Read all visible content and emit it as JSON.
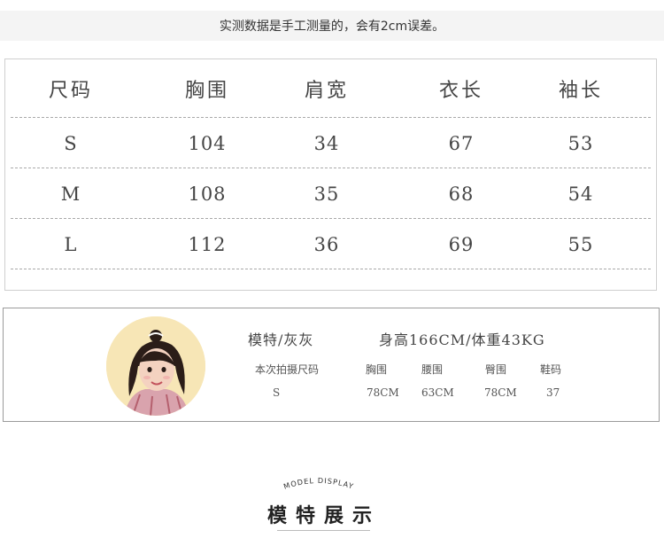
{
  "notice": "实测数据是手工测量的，会有2cm误差。",
  "size_table": {
    "headers": [
      "尺码",
      "胸围",
      "肩宽",
      "衣长",
      "袖长"
    ],
    "rows": [
      [
        "S",
        "104",
        "34",
        "67",
        "53"
      ],
      [
        "M",
        "108",
        "35",
        "68",
        "54"
      ],
      [
        "L",
        "112",
        "36",
        "69",
        "55"
      ]
    ]
  },
  "model": {
    "name": "模特/灰灰",
    "body": "身高166CM/体重43KG",
    "headers": [
      "本次拍摄尺码",
      "胸围",
      "腰围",
      "臀围",
      "鞋码"
    ],
    "values": [
      "S",
      "78CM",
      "63CM",
      "78CM",
      "37"
    ]
  },
  "display": {
    "en": "MODEL DISPLAY",
    "title": "模特展示"
  }
}
